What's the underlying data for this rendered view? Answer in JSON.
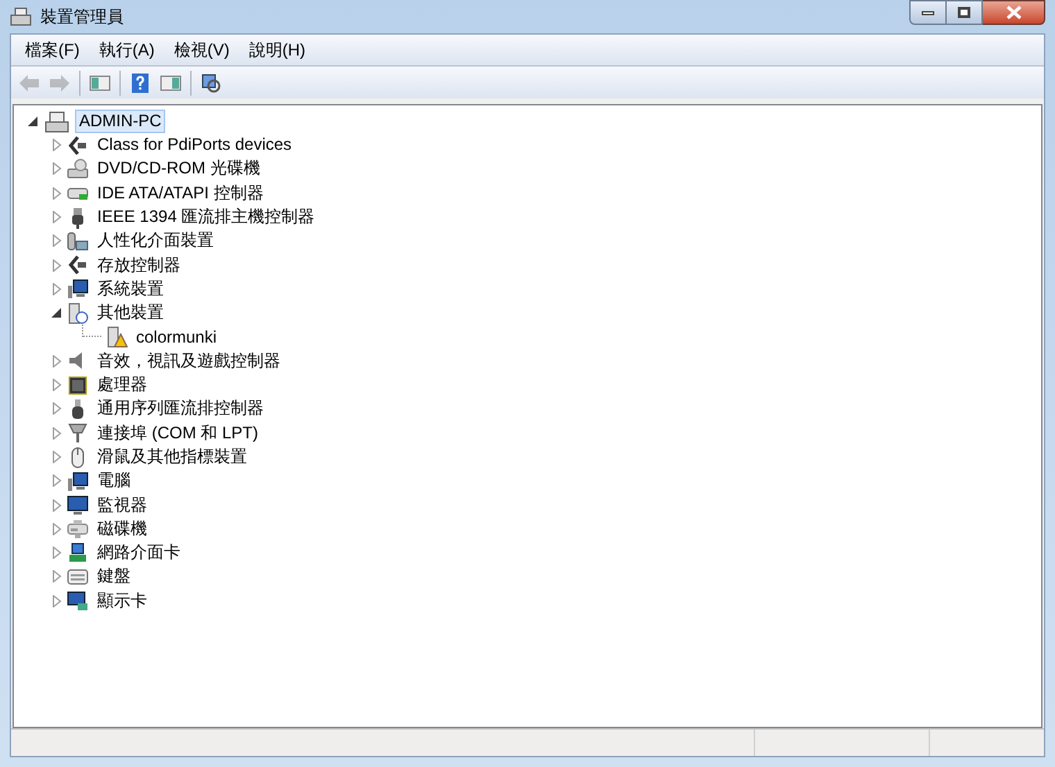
{
  "window": {
    "title": "裝置管理員"
  },
  "menu": [
    "檔案(F)",
    "執行(A)",
    "檢視(V)",
    "說明(H)"
  ],
  "toolbar": [
    {
      "kind": "back",
      "disabled": true
    },
    {
      "kind": "forward",
      "disabled": true
    },
    {
      "kind": "sep"
    },
    {
      "kind": "tree",
      "disabled": false
    },
    {
      "kind": "sep"
    },
    {
      "kind": "help",
      "disabled": false
    },
    {
      "kind": "pane",
      "disabled": false
    },
    {
      "kind": "sep"
    },
    {
      "kind": "scan",
      "disabled": false
    }
  ],
  "tree": {
    "label": "ADMIN-PC",
    "expanded": true,
    "selected": true,
    "children": [
      {
        "label": "Class for PdiPorts devices",
        "expanded": false,
        "selected": false
      },
      {
        "label": "DVD/CD-ROM 光碟機",
        "expanded": false,
        "selected": false
      },
      {
        "label": "IDE ATA/ATAPI 控制器",
        "expanded": false,
        "selected": false
      },
      {
        "label": "IEEE 1394 匯流排主機控制器",
        "expanded": false,
        "selected": false
      },
      {
        "label": "人性化介面裝置",
        "expanded": false,
        "selected": false
      },
      {
        "label": "存放控制器",
        "expanded": false,
        "selected": false
      },
      {
        "label": "系統裝置",
        "expanded": false,
        "selected": false
      },
      {
        "label": "其他裝置",
        "expanded": true,
        "selected": false,
        "children": [
          {
            "label": "colormunki",
            "selected": false,
            "warning": true
          }
        ]
      },
      {
        "label": "音效，視訊及遊戲控制器",
        "expanded": false,
        "selected": false
      },
      {
        "label": "處理器",
        "expanded": false,
        "selected": false
      },
      {
        "label": "通用序列匯流排控制器",
        "expanded": false,
        "selected": false
      },
      {
        "label": "連接埠 (COM 和 LPT)",
        "expanded": false,
        "selected": false
      },
      {
        "label": "滑鼠及其他指標裝置",
        "expanded": false,
        "selected": false
      },
      {
        "label": "電腦",
        "expanded": false,
        "selected": false
      },
      {
        "label": "監視器",
        "expanded": false,
        "selected": false
      },
      {
        "label": "磁碟機",
        "expanded": false,
        "selected": false
      },
      {
        "label": "網路介面卡",
        "expanded": false,
        "selected": false
      },
      {
        "label": "鍵盤",
        "expanded": false,
        "selected": false
      },
      {
        "label": "顯示卡",
        "expanded": false,
        "selected": false
      }
    ]
  }
}
